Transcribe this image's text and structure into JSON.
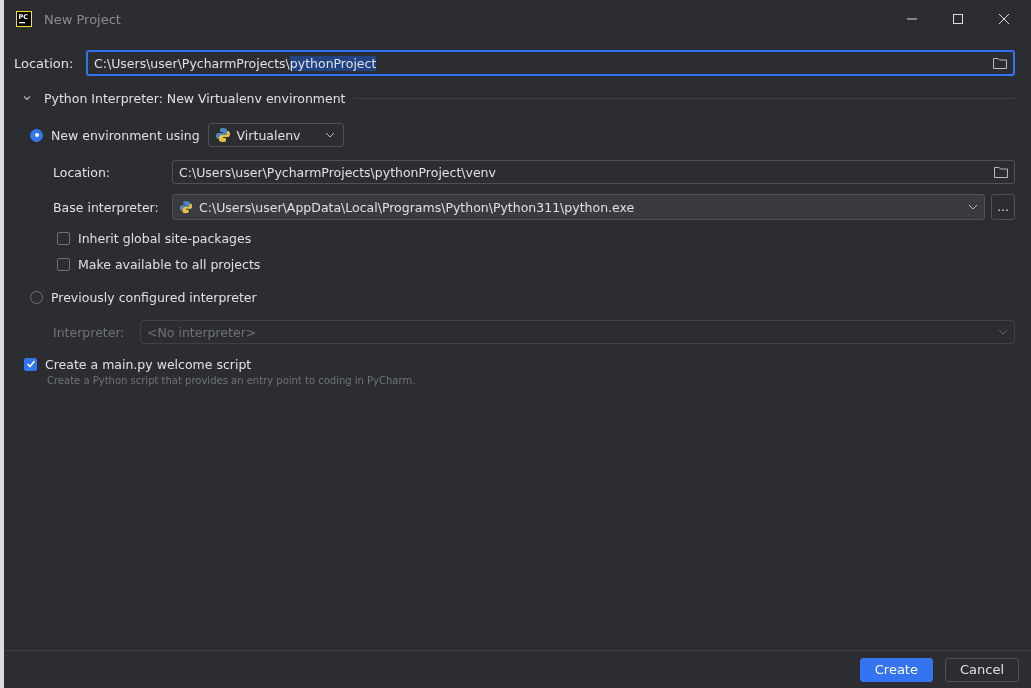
{
  "window": {
    "title": "New Project",
    "logo_text": "PC"
  },
  "location": {
    "label": "Location:",
    "value_parts": [
      {
        "text": "C:\\Users\\user\\PycharmProjects\\",
        "selected": false
      },
      {
        "text": "pythonProject",
        "selected": true
      }
    ],
    "focused": true
  },
  "interpreter_section": {
    "title": "Python Interpreter: New Virtualenv environment",
    "expanded": true,
    "options": [
      {
        "label": "New environment using",
        "selected": true,
        "tool": "Virtualenv",
        "location": {
          "label": "Location:",
          "value": "C:\\Users\\user\\PycharmProjects\\pythonProject\\venv"
        },
        "base_interpreter": {
          "label": "Base interpreter:",
          "value": "C:\\Users\\user\\AppData\\Local\\Programs\\Python\\Python311\\python.exe",
          "browse": "..."
        },
        "checkboxes": [
          {
            "label": "Inherit global site-packages",
            "checked": false
          },
          {
            "label": "Make available to all projects",
            "checked": false
          }
        ]
      },
      {
        "label": "Previously configured interpreter",
        "selected": false,
        "interpreter": {
          "label": "Interpreter:",
          "placeholder": "<No interpreter>",
          "disabled": true
        }
      }
    ]
  },
  "welcome_script": {
    "label": "Create a main.py welcome script",
    "checked": true,
    "hint": "Create a Python script that provides an entry point to coding in PyCharm."
  },
  "buttons": [
    {
      "label": "Create",
      "kind": "primary"
    },
    {
      "label": "Cancel",
      "kind": "secondary"
    }
  ]
}
